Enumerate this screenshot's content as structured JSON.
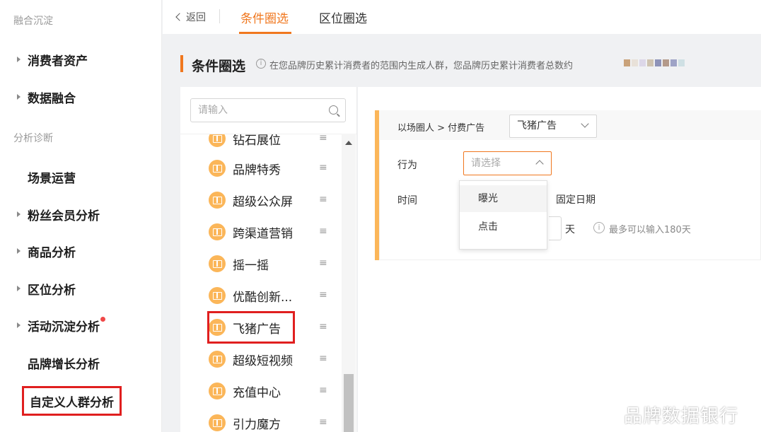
{
  "sidebar": {
    "sections": [
      "融合沉淀",
      "分析诊断"
    ],
    "items": [
      {
        "label": "消费者资产",
        "arrow": true
      },
      {
        "label": "数据融合",
        "arrow": true
      },
      {
        "label": "场景运营",
        "arrow": false
      },
      {
        "label": "粉丝会员分析",
        "arrow": true
      },
      {
        "label": "商品分析",
        "arrow": true
      },
      {
        "label": "区位分析",
        "arrow": true
      },
      {
        "label": "活动沉淀分析",
        "arrow": true,
        "badge": "red-dot"
      },
      {
        "label": "品牌增长分析",
        "arrow": false
      },
      {
        "label": "自定义人群分析",
        "arrow": false,
        "highlighted": true
      }
    ]
  },
  "topbar": {
    "back_label": "返回",
    "tabs": [
      {
        "label": "条件圈选",
        "active": true
      },
      {
        "label": "区位圈选",
        "active": false
      }
    ]
  },
  "section": {
    "title": "条件圈选",
    "info_icon": "i",
    "description": "在您品牌历史累计消费者的范围内生成人群，您品牌历史累计消费者总数约"
  },
  "left_panel": {
    "search_placeholder": "请输入",
    "items": [
      {
        "label": "钻石展位"
      },
      {
        "label": "品牌特秀"
      },
      {
        "label": "超级公众屏"
      },
      {
        "label": "跨渠道营销"
      },
      {
        "label": "摇一摇"
      },
      {
        "label": "优酷创新..."
      },
      {
        "label": "飞猪广告",
        "highlighted": true
      },
      {
        "label": "超级短视频"
      },
      {
        "label": "充值中心"
      },
      {
        "label": "引力魔方"
      }
    ],
    "drag_glyph": "≡"
  },
  "condition_card": {
    "breadcrumb": "以场圈人 > 付费广告",
    "source_select": "飞猪广告",
    "action_label": "行为",
    "action_placeholder": "请选择",
    "time_label": "时间",
    "fixed_date": "固定日期",
    "days_unit": "天",
    "hint_icon": "i",
    "hint": "最多可以输入180天",
    "dropdown_options": [
      "曝光",
      "点击"
    ]
  },
  "watermark": "品牌数据银行",
  "colors": {
    "accent": "#f0771e",
    "icon_bg": "#fbb659",
    "highlight_box": "#e01f1f",
    "badge": "#f04848"
  }
}
